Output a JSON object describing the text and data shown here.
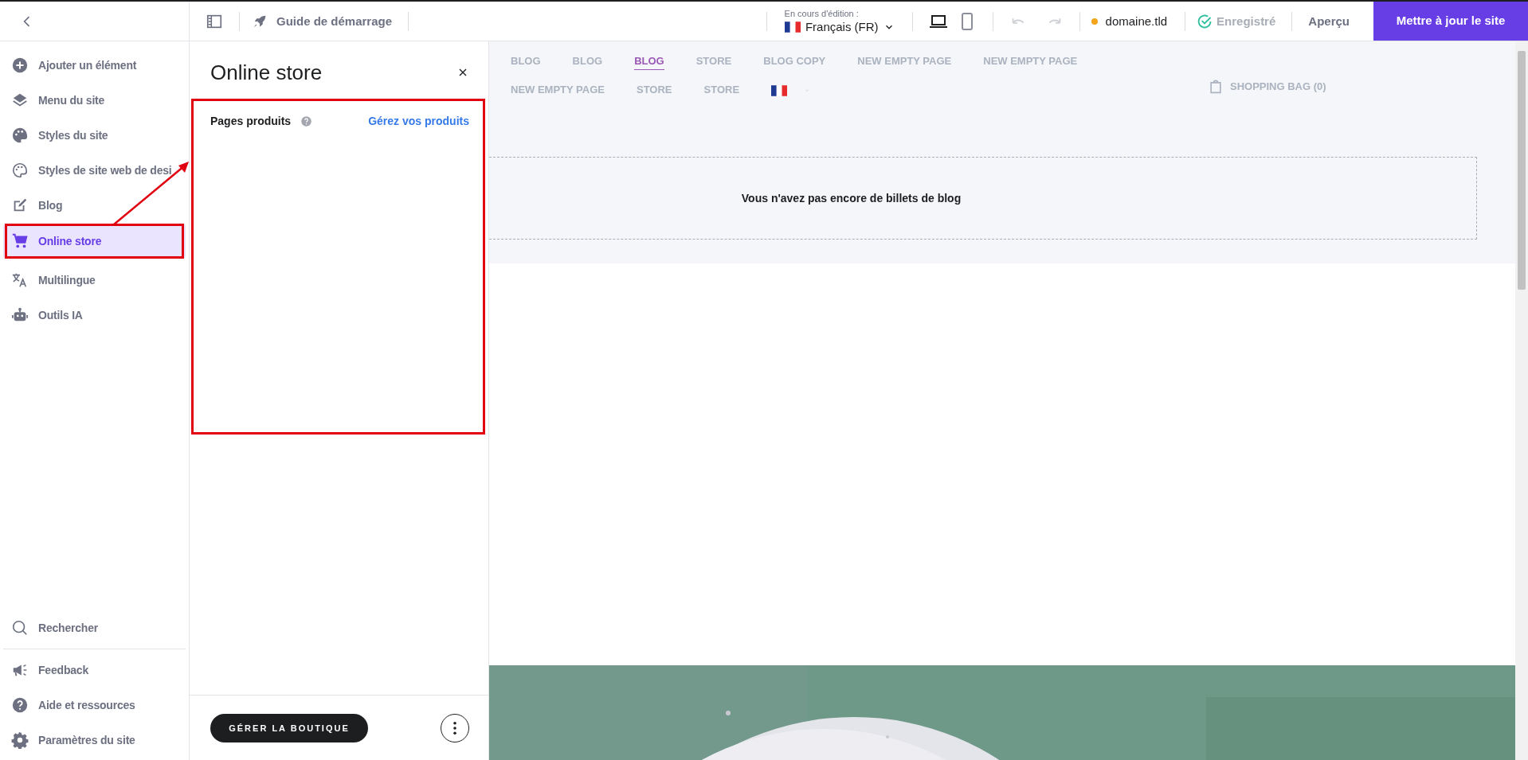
{
  "topbar": {
    "guide": "Guide de démarrage",
    "editing_label": "En cours d'édition :",
    "language": "Français (FR)",
    "domain": "domaine.tld",
    "save_status": {
      "label": "Enregistré",
      "disabled": true
    },
    "preview": "Aperçu",
    "publish": "Mettre à jour le site"
  },
  "sidebar": {
    "items": [
      {
        "label": "Ajouter un élément",
        "selected": false
      },
      {
        "label": "Menu du site",
        "selected": false
      },
      {
        "label": "Styles du site",
        "selected": false
      },
      {
        "label": "Styles de site web de desi",
        "selected": false
      },
      {
        "label": "Blog",
        "selected": false
      },
      {
        "label": "Online store",
        "selected": true
      },
      {
        "label": "Multilingue",
        "selected": false
      },
      {
        "label": "Outils IA",
        "selected": false
      }
    ],
    "bottom_items": [
      {
        "label": "Rechercher"
      },
      {
        "label": "Feedback"
      },
      {
        "label": "Aide et ressources"
      },
      {
        "label": "Paramètres du site"
      }
    ]
  },
  "panel": {
    "title": "Online store",
    "section_label": "Pages produits",
    "link": "Gérez vos produits",
    "primary_button": "GÉRER LA BOUTIQUE"
  },
  "preview": {
    "nav_rows": [
      [
        {
          "label": "BLOG",
          "selected": false
        },
        {
          "label": "BLOG",
          "selected": false
        },
        {
          "label": "BLOG",
          "selected": true
        },
        {
          "label": "STORE",
          "selected": false
        },
        {
          "label": "BLOG COPY",
          "selected": false
        },
        {
          "label": "NEW EMPTY PAGE",
          "selected": false
        },
        {
          "label": "NEW EMPTY PAGE",
          "selected": false
        }
      ],
      [
        {
          "label": "NEW EMPTY PAGE",
          "selected": false
        },
        {
          "label": "STORE",
          "selected": false
        },
        {
          "label": "STORE",
          "selected": false
        }
      ]
    ],
    "cart": "SHOPPING BAG (0)",
    "empty_message": "Vous n'avez pas encore de billets de blog",
    "hero": {
      "kind": "picture"
    }
  }
}
